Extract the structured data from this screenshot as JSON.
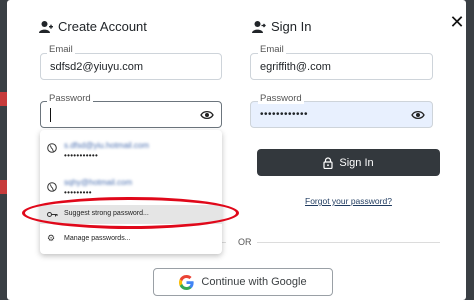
{
  "create_account": {
    "title": "Create Account",
    "email_label": "Email",
    "email_value": "sdfsd2@yiuyu.com",
    "password_label": "Password",
    "password_value": ""
  },
  "sign_in": {
    "title": "Sign In",
    "email_label": "Email",
    "email_value": "egriffith@.com",
    "password_label": "Password",
    "password_value": "••••••••••••",
    "button_label": "Sign In",
    "forgot_link": "Forgot your password?"
  },
  "autofill_dropdown": {
    "accounts": [
      {
        "name": "s.dfsd@yiu.hotmail.com",
        "masked": "•••••••••••"
      },
      {
        "name": "sqhy@hotmail.com",
        "masked": "•••••••••"
      }
    ],
    "suggest_label": "Suggest strong password...",
    "manage_label": "Manage passwords..."
  },
  "divider_text": "OR",
  "google_button_label": "Continue with Google",
  "icons": {
    "close": "close-icon",
    "user_plus": "user-plus-icon",
    "user_login": "user-login-icon",
    "eye": "eye-icon",
    "globe": "globe-icon",
    "key": "key-icon",
    "gear": "gear-icon",
    "lock": "lock-icon",
    "google": "google-logo-icon"
  },
  "colors": {
    "primary_button": "#33383d",
    "autofill_bg": "#e8f0fe",
    "annotation": "#e0081a",
    "link": "#1e3a5f"
  }
}
